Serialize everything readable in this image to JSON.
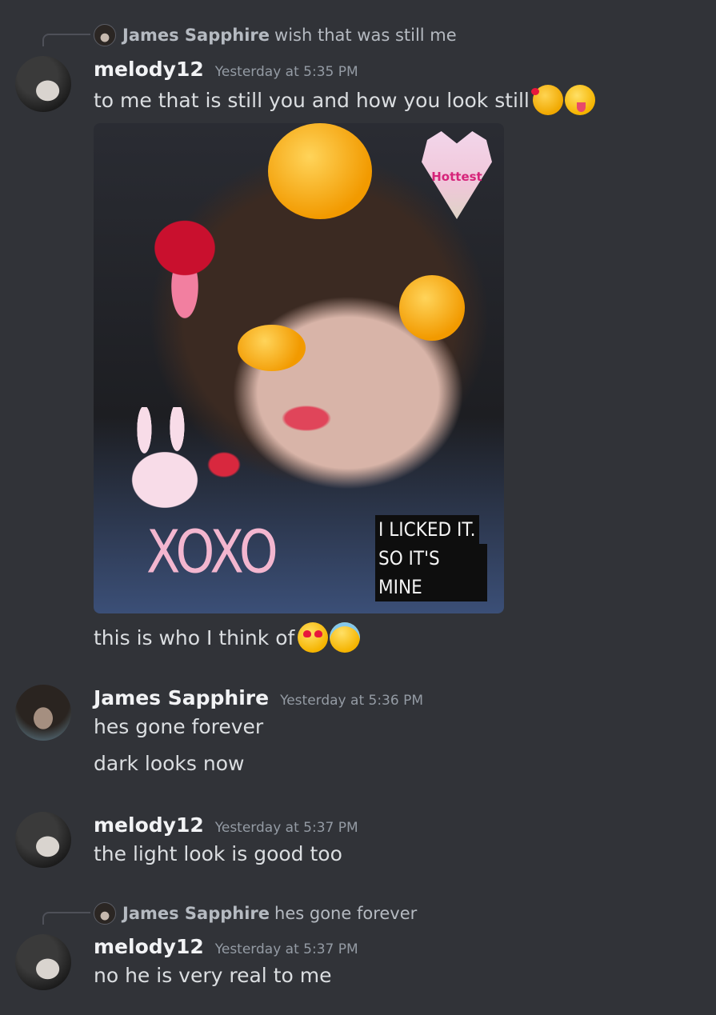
{
  "messages": [
    {
      "reply": {
        "author": "James Sapphire",
        "text": "wish that was still me"
      },
      "author": "melody12",
      "timestamp": "Yesterday at 5:35 PM",
      "lines": [
        {
          "text": "to me that is still you and how you look still",
          "emojis": [
            "smiling-face-with-hearts-emoji",
            "winking-face-with-tongue-emoji"
          ]
        },
        {
          "text": "this is who I think of",
          "emojis": [
            "heart-eyes-emoji",
            "smiling-face-with-halo-emoji"
          ]
        }
      ],
      "attachment": {
        "sticker_text_heart": "Hottest",
        "sticker_text_xoxo": "XOXO",
        "caption_line1": "I LICKED IT.",
        "caption_line2": "SO IT'S MINE"
      }
    },
    {
      "author": "James Sapphire",
      "timestamp": "Yesterday at 5:36 PM",
      "lines": [
        {
          "text": "hes gone forever"
        },
        {
          "text": "dark looks now"
        }
      ]
    },
    {
      "author": "melody12",
      "timestamp": "Yesterday at 5:37 PM",
      "lines": [
        {
          "text": "the light look is good too"
        }
      ]
    },
    {
      "reply": {
        "author": "James Sapphire",
        "text": "hes gone forever"
      },
      "author": "melody12",
      "timestamp": "Yesterday at 5:37 PM",
      "lines": [
        {
          "text": "no he is very real to me"
        }
      ]
    }
  ],
  "colors": {
    "background": "#313338",
    "username": "#f2f3f5",
    "timestamp": "#949ba4",
    "message_text": "#dbdee1",
    "reply_text": "#b5bac1"
  }
}
